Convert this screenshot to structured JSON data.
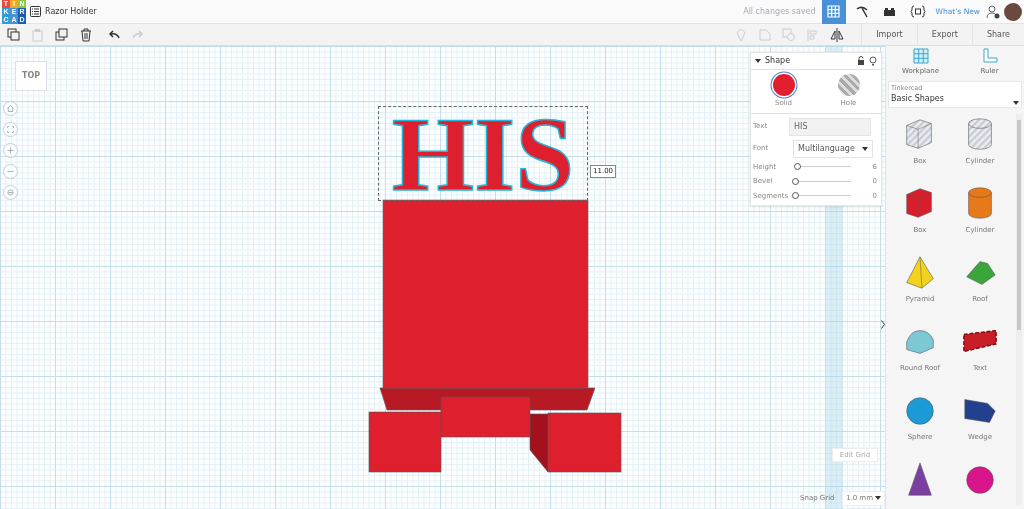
{
  "topbar": {
    "logo_letters": [
      "T",
      "I",
      "N",
      "K",
      "E",
      "R",
      "C",
      "A",
      "D"
    ],
    "title": "Razor Holder",
    "save_status": "All changes saved",
    "views": [
      {
        "kind": "grid",
        "selected": true
      },
      {
        "kind": "pickaxe",
        "selected": false
      },
      {
        "kind": "bricks",
        "selected": false
      },
      {
        "kind": "code",
        "selected": false
      }
    ],
    "whats_new": "What's New"
  },
  "toolbar": {
    "left_tools": [
      {
        "kind": "copy",
        "disabled": false
      },
      {
        "kind": "paste",
        "disabled": true
      },
      {
        "kind": "duplicate",
        "disabled": false
      },
      {
        "kind": "delete",
        "disabled": false
      },
      {
        "kind": "undo",
        "disabled": false
      },
      {
        "kind": "redo",
        "disabled": true
      }
    ],
    "right_tools": [
      {
        "kind": "note",
        "disabled": true
      },
      {
        "kind": "comment",
        "disabled": true
      },
      {
        "kind": "group",
        "disabled": true
      },
      {
        "kind": "align",
        "disabled": true
      },
      {
        "kind": "mirror",
        "disabled": false
      }
    ],
    "buttons": [
      "Import",
      "Export",
      "Share"
    ]
  },
  "view_cube": "TOP",
  "nav_buttons": [
    {
      "kind": "home"
    },
    {
      "kind": "fit"
    },
    {
      "kind": "zoom-in"
    },
    {
      "kind": "zoom-out"
    },
    {
      "kind": "orbit"
    }
  ],
  "model": {
    "text": "HIS",
    "dimension": "11.00"
  },
  "inspector": {
    "title": "Shape",
    "modes": [
      {
        "label": "Solid",
        "selected": true
      },
      {
        "label": "Hole",
        "selected": false
      }
    ],
    "text_label": "Text",
    "text_value": "HIS",
    "font_label": "Font",
    "font_value": "Multilanguage",
    "sliders": [
      {
        "label": "Height",
        "level": 0.04,
        "reading": "6"
      },
      {
        "label": "Bevel",
        "level": 0,
        "reading": "0"
      },
      {
        "label": "Segments",
        "level": 0,
        "reading": "0"
      }
    ]
  },
  "grid_controls": {
    "edit_grid": "Edit Grid",
    "snap_label": "Snap Grid",
    "snap_value": "1.0 mm"
  },
  "library": {
    "tools": [
      "Workplane",
      "Ruler"
    ],
    "source": "Tinkercad",
    "category": "Basic Shapes",
    "shapes": [
      {
        "label": "Box",
        "kind": "box",
        "color": "#c8ccd4",
        "hole": true
      },
      {
        "label": "Cylinder",
        "kind": "cylinder",
        "color": "#c8ccd4",
        "hole": true
      },
      {
        "label": "Box",
        "kind": "box",
        "color": "#d91e2b",
        "hole": false
      },
      {
        "label": "Cylinder",
        "kind": "cylinder",
        "color": "#e8791a",
        "hole": false
      },
      {
        "label": "Pyramid",
        "kind": "pyramid",
        "color": "#f2d21c",
        "hole": false
      },
      {
        "label": "Roof",
        "kind": "roof",
        "color": "#3aa53a",
        "hole": false
      },
      {
        "label": "Round Roof",
        "kind": "roundroof",
        "color": "#7cc8d4",
        "hole": false
      },
      {
        "label": "Text",
        "kind": "text",
        "color": "#c81e28",
        "hole": false
      },
      {
        "label": "Sphere",
        "kind": "sphere",
        "color": "#1b9ad6",
        "hole": false
      },
      {
        "label": "Wedge",
        "kind": "wedge",
        "color": "#23408e",
        "hole": false
      },
      {
        "kind": "cone",
        "color": "#7b3fa0",
        "hole": false
      },
      {
        "kind": "sphere",
        "color": "#d8158a",
        "hole": false
      }
    ]
  }
}
